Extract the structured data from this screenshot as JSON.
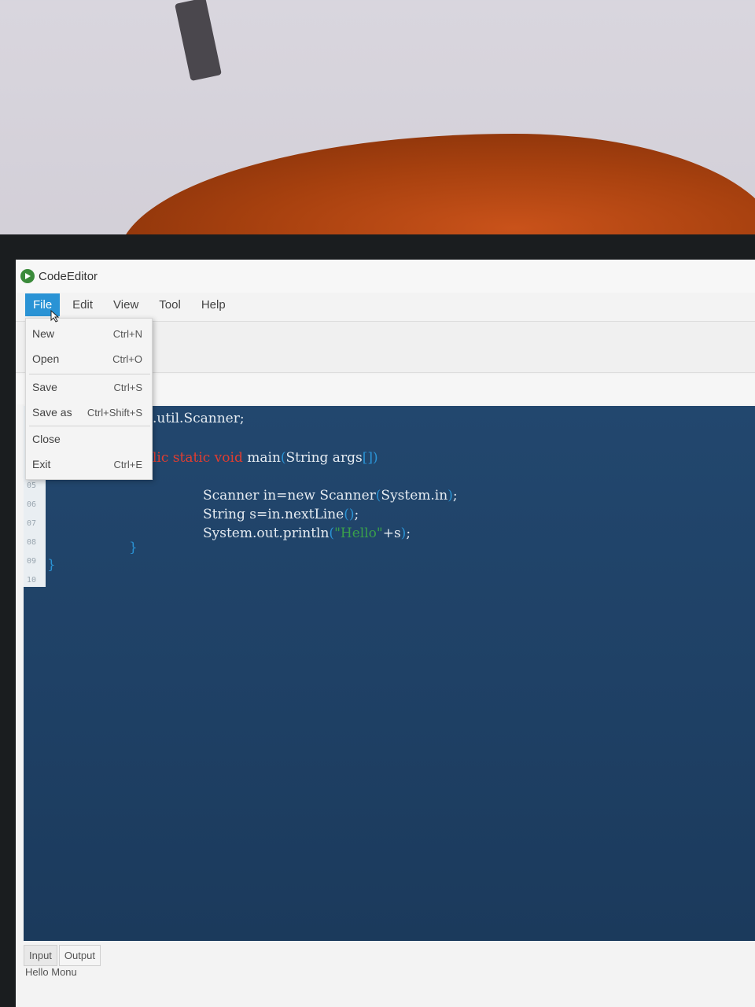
{
  "window": {
    "title": "CodeEditor",
    "icon": "app-logo-icon"
  },
  "menubar": {
    "items": [
      {
        "label": "File",
        "active": true
      },
      {
        "label": "Edit",
        "active": false
      },
      {
        "label": "View",
        "active": false
      },
      {
        "label": "Tool",
        "active": false
      },
      {
        "label": "Help",
        "active": false
      }
    ]
  },
  "file_menu": {
    "items": [
      {
        "label": "New",
        "shortcut": "Ctrl+N"
      },
      {
        "label": "Open",
        "shortcut": "Ctrl+O"
      },
      {
        "label": "Save",
        "shortcut": "Ctrl+S"
      },
      {
        "label": "Save as",
        "shortcut": "Ctrl+Shift+S"
      },
      {
        "label": "Close",
        "shortcut": ""
      },
      {
        "label": "Exit",
        "shortcut": "Ctrl+E"
      }
    ]
  },
  "editor": {
    "line_numbers": [
      "05",
      "06",
      "07",
      "08",
      "09",
      "10"
    ],
    "line_import": ".util.Scanner;",
    "line_main": {
      "kw1": "lic static void",
      "name": " main",
      "open": "(",
      "params": "String args",
      "close": "[])"
    },
    "line_scanner": {
      "text": "Scanner in=new Scanner",
      "open": "(",
      "arg": "System.in",
      "close": ")",
      "end": ";"
    },
    "line_string": {
      "text": "String s=in.nextLine",
      "parens": "()",
      "end": ";"
    },
    "line_print": {
      "text": "System.out.println",
      "open": "(",
      "str": "\"Hello\"",
      "rest": "+s",
      "close": ")",
      "end": ";"
    },
    "brace_inner": "}",
    "brace_outer": "}"
  },
  "io_panel": {
    "tabs": [
      "Input",
      "Output"
    ],
    "active_tab": "Output",
    "output_text": "Hello Monu"
  },
  "colors": {
    "accent": "#2a93d5",
    "editor_bg": "#1f4166",
    "keyword": "#e23d2f",
    "string": "#3aa04a"
  }
}
